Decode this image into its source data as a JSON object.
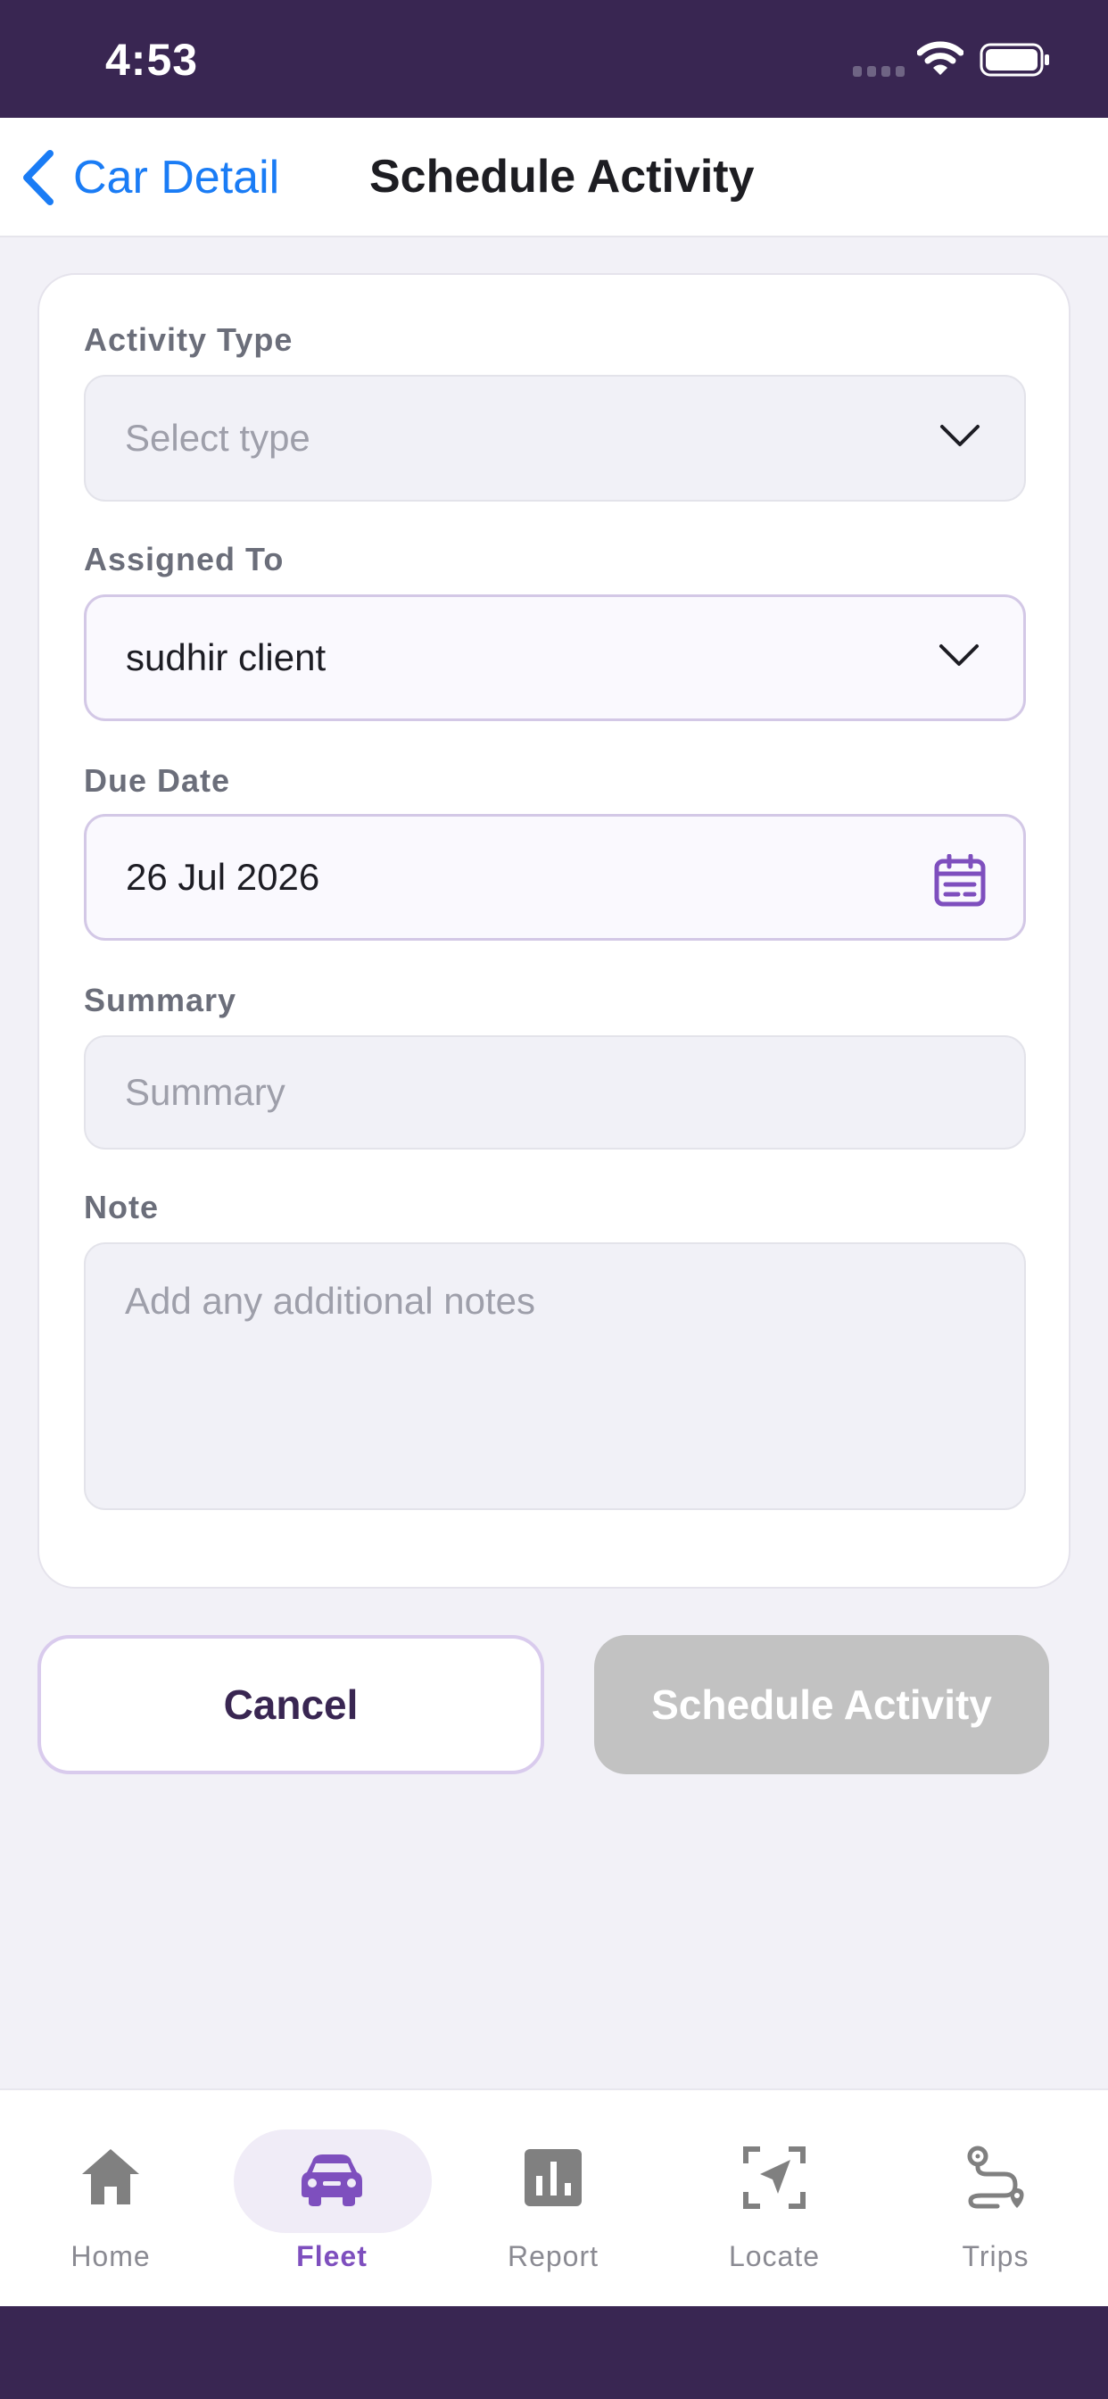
{
  "status_bar": {
    "time": "4:53"
  },
  "nav": {
    "back_label": "Car Detail",
    "title": "Schedule Activity"
  },
  "form": {
    "activity_type": {
      "label": "Activity Type",
      "placeholder": "Select type",
      "value": ""
    },
    "assigned_to": {
      "label": "Assigned To",
      "value": "sudhir client"
    },
    "due_date": {
      "label": "Due Date",
      "value": "26 Jul 2026"
    },
    "summary": {
      "label": "Summary",
      "placeholder": "Summary",
      "value": ""
    },
    "note": {
      "label": "Note",
      "placeholder": "Add any additional notes",
      "value": ""
    }
  },
  "actions": {
    "cancel_label": "Cancel",
    "schedule_label": "Schedule Activity"
  },
  "tabs": [
    {
      "label": "Home",
      "icon": "home-icon",
      "active": false
    },
    {
      "label": "Fleet",
      "icon": "car-icon",
      "active": true
    },
    {
      "label": "Report",
      "icon": "bar-chart-icon",
      "active": false
    },
    {
      "label": "Locate",
      "icon": "locate-icon",
      "active": false
    },
    {
      "label": "Trips",
      "icon": "route-icon",
      "active": false
    }
  ],
  "colors": {
    "brand_dark": "#392652",
    "accent": "#7e4fbe",
    "link_blue": "#1a7cf5",
    "disabled_button": "#c2c2c2"
  }
}
